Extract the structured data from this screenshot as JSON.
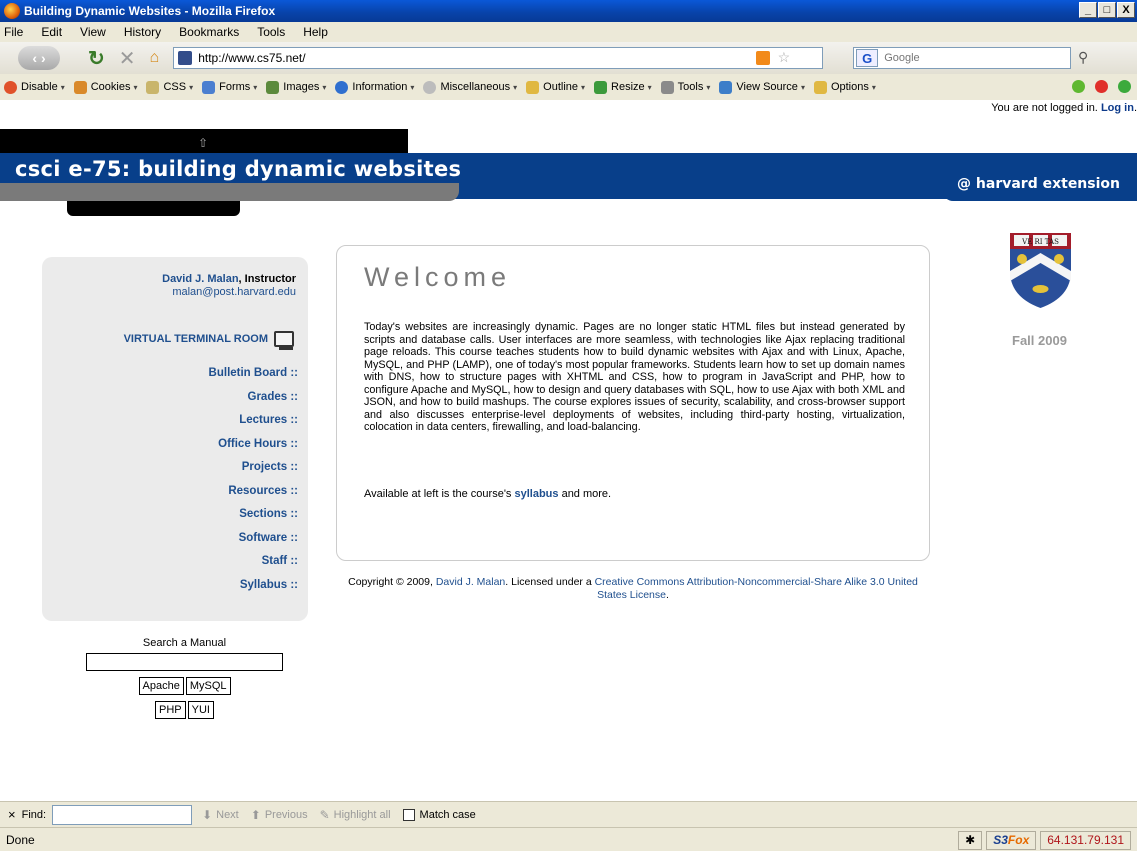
{
  "window": {
    "title": "Building Dynamic Websites - Mozilla Firefox",
    "controls": [
      "_",
      "□",
      "X"
    ]
  },
  "menu": [
    "File",
    "Edit",
    "View",
    "History",
    "Bookmarks",
    "Tools",
    "Help"
  ],
  "navbar": {
    "url": "http://www.cs75.net/",
    "search_placeholder": "Google"
  },
  "devbar": {
    "items": [
      "Disable",
      "Cookies",
      "CSS",
      "Forms",
      "Images",
      "Information",
      "Miscellaneous",
      "Outline",
      "Resize",
      "Tools",
      "View Source",
      "Options"
    ],
    "icon_colors": [
      "#e0522a",
      "#d9892a",
      "#c9b56b",
      "#4b7fd0",
      "#5c8a3c",
      "#2f6fcf",
      "#bcbcbc",
      "#e0b842",
      "#3c9a3c",
      "#8a8a8a",
      "#3d7ec9",
      "#e0b842"
    ]
  },
  "page": {
    "login_text": "You are not logged in.",
    "login_link": "Log in",
    "banner_title": "csci e-75: building dynamic websites",
    "banner_right": "@ harvard extension",
    "instructor_name": "David J. Malan",
    "instructor_role": ", Instructor",
    "instructor_email": "malan@post.harvard.edu",
    "virtual_terminal": "VIRTUAL TERMINAL ROOM",
    "nav": [
      "Bulletin Board ::",
      "Grades ::",
      "Lectures ::",
      "Office Hours ::",
      "Projects ::",
      "Resources ::",
      "Sections ::",
      "Software ::",
      "Staff ::",
      "Syllabus ::"
    ],
    "search_label": "Search a Manual",
    "manual_buttons_row1": [
      "Apache",
      "MySQL"
    ],
    "manual_buttons_row2": [
      "PHP",
      "YUI"
    ],
    "welcome_heading": "Welcome",
    "intro": "Today's websites are increasingly dynamic. Pages are no longer static HTML files but instead generated by scripts and database calls. User interfaces are more seamless, with technologies like Ajax replacing traditional page reloads. This course teaches students how to build dynamic websites with Ajax and with Linux, Apache, MySQL, and PHP (LAMP), one of today's most popular frameworks. Students learn how to set up domain names with DNS, how to structure pages with XHTML and CSS, how to program in JavaScript and PHP, how to configure Apache and MySQL, how to design and query databases with SQL, how to use Ajax with both XML and JSON, and how to build mashups. The course explores issues of security, scalability, and cross-browser support and also discusses enterprise-level deployments of websites, including third-party hosting, virtualization, colocation in data centers, firewalling, and load-balancing.",
    "available_pre": "Available at left is the course's ",
    "available_link": "syllabus",
    "available_post": " and more.",
    "copyright_pre": "Copyright © 2009, ",
    "copyright_author": "David J. Malan",
    "copyright_mid": ". Licensed under a ",
    "copyright_license": "Creative Commons Attribution-Noncommercial-Share Alike 3.0 United States License",
    "copyright_end": ".",
    "shield_text": "VE RI TAS",
    "term": "Fall 2009"
  },
  "findbar": {
    "close": "×",
    "label": "Find:",
    "next": "Next",
    "previous": "Previous",
    "highlight": "Highlight all",
    "matchcase": "Match case"
  },
  "statusbar": {
    "status": "Done",
    "s3": "S3",
    "fox": "Fox",
    "ip": "64.131.79.131"
  }
}
